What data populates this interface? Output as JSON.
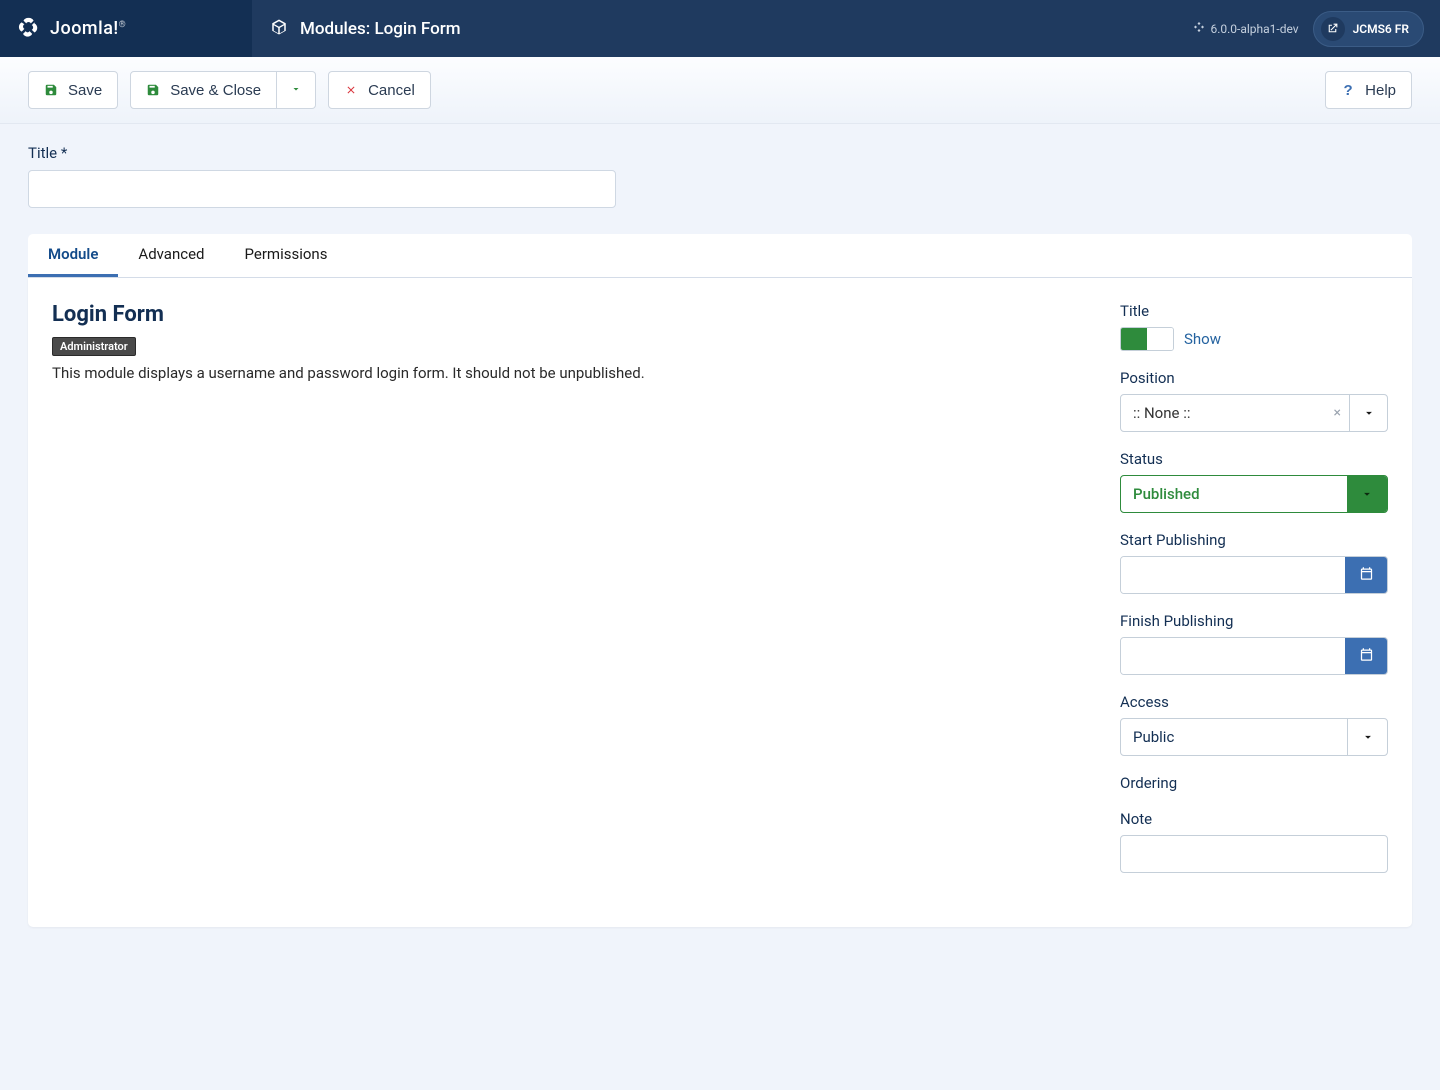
{
  "brand": {
    "name": "Joomla!"
  },
  "header": {
    "title": "Modules: Login Form"
  },
  "topright": {
    "version": "6.0.0-alpha1-dev",
    "site": "JCMS6 FR"
  },
  "toolbar": {
    "save": "Save",
    "save_close": "Save & Close",
    "cancel": "Cancel",
    "help": "Help"
  },
  "form": {
    "title_label": "Title *"
  },
  "tabs": {
    "module": "Module",
    "advanced": "Advanced",
    "permissions": "Permissions"
  },
  "module": {
    "heading": "Login Form",
    "badge": "Administrator",
    "desc": "This module displays a username and password login form. It should not be unpublished."
  },
  "sidebar": {
    "title_label": "Title",
    "title_toggle_value": "Show",
    "position_label": "Position",
    "position_value": ":: None ::",
    "status_label": "Status",
    "status_value": "Published",
    "start_label": "Start Publishing",
    "finish_label": "Finish Publishing",
    "access_label": "Access",
    "access_value": "Public",
    "ordering_label": "Ordering",
    "note_label": "Note"
  }
}
